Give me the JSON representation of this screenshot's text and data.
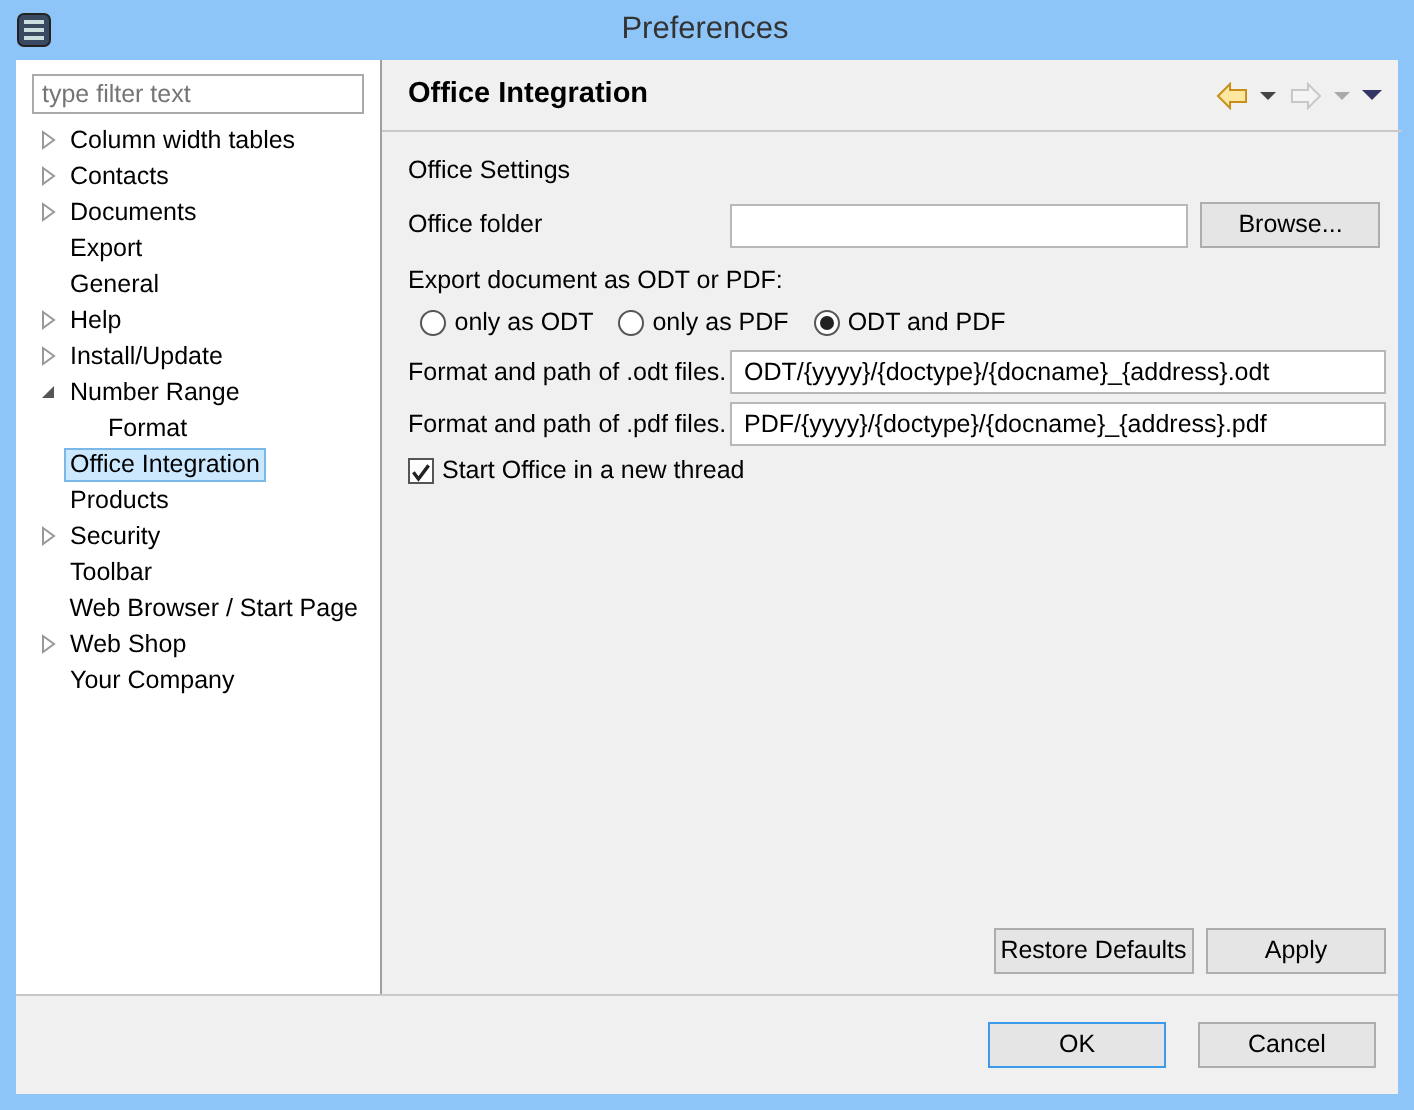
{
  "window": {
    "title": "Preferences"
  },
  "filter": {
    "placeholder": "type filter text"
  },
  "tree": [
    {
      "label": "Column width tables",
      "expanded": false,
      "selected": false
    },
    {
      "label": "Contacts",
      "expanded": false,
      "selected": false
    },
    {
      "label": "Documents",
      "expanded": false,
      "selected": false
    },
    {
      "label": "Export",
      "selected": false
    },
    {
      "label": "General",
      "selected": false
    },
    {
      "label": "Help",
      "expanded": false,
      "selected": false
    },
    {
      "label": "Install/Update",
      "expanded": false,
      "selected": false
    },
    {
      "label": "Number Range",
      "expanded": true,
      "selected": false,
      "children": [
        {
          "label": "Format",
          "selected": false
        }
      ]
    },
    {
      "label": "Office Integration",
      "selected": true
    },
    {
      "label": "Products",
      "selected": false
    },
    {
      "label": "Security",
      "expanded": false,
      "selected": false
    },
    {
      "label": "Toolbar",
      "selected": false
    },
    {
      "label": "Web Browser / Start Page",
      "selected": false
    },
    {
      "label": "Web Shop",
      "expanded": false,
      "selected": false
    },
    {
      "label": "Your Company",
      "selected": false
    }
  ],
  "page": {
    "title": "Office Integration",
    "section": "Office Settings",
    "folder": {
      "label": "Office folder",
      "button": "Browse..."
    },
    "export": {
      "label": "Export document as ODT or PDF:",
      "options": [
        {
          "label": "only as ODT",
          "selected": false
        },
        {
          "label": "only as PDF",
          "selected": false
        },
        {
          "label": "ODT and PDF",
          "selected": true
        }
      ]
    },
    "paths": [
      {
        "label": "Format and path of .odt files.",
        "value": "ODT/{yyyy}/{doctype}/{docname}_{address}.odt"
      },
      {
        "label": "Format and path of .pdf files.",
        "value": "PDF/{yyyy}/{doctype}/{docname}_{address}.pdf"
      }
    ],
    "thread": {
      "label": "Start Office in a new thread",
      "checked": true
    },
    "buttons": [
      "Restore Defaults",
      "Apply"
    ]
  },
  "dialog_buttons": [
    {
      "label": "OK",
      "default": true
    },
    {
      "label": "Cancel",
      "default": false
    }
  ]
}
